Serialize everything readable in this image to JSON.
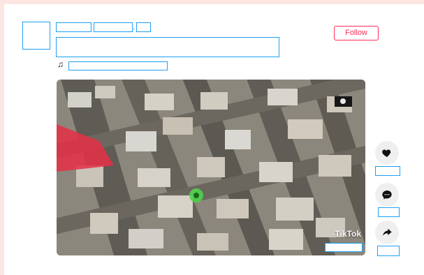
{
  "post": {
    "follow_label": "Follow"
  },
  "video": {
    "watermark": "TikTok"
  },
  "actions": {
    "like_icon": "heart-icon",
    "comment_icon": "comment-icon",
    "share_icon": "share-icon"
  },
  "colors": {
    "accent": "#fe2c55",
    "redaction_outline": "#1e9ff2"
  }
}
